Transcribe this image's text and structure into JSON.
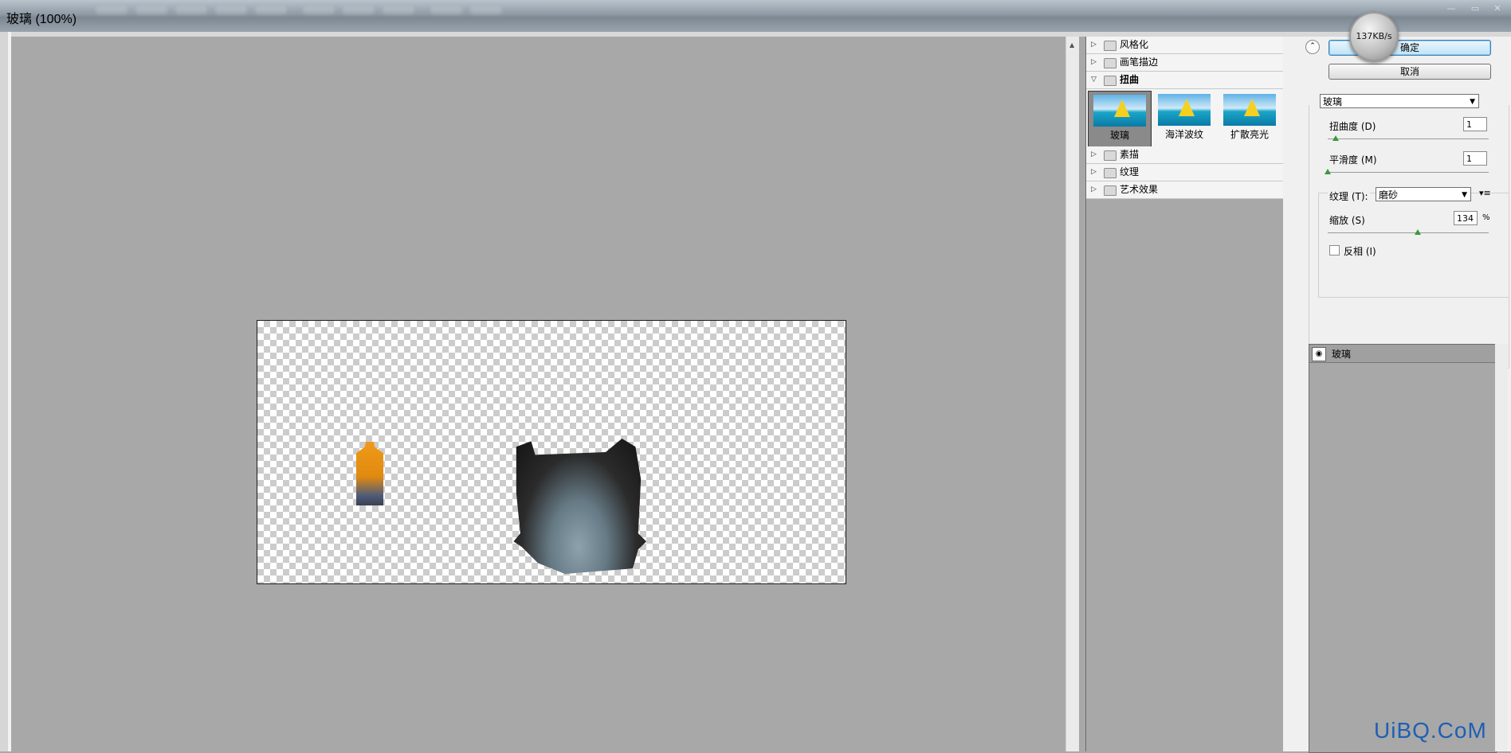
{
  "window": {
    "title": "玻璃 (100%)",
    "speed_badge": "137KB/s"
  },
  "filter_gallery": {
    "folders": [
      {
        "label": "风格化",
        "expanded": false
      },
      {
        "label": "画笔描边",
        "expanded": false
      },
      {
        "label": "扭曲",
        "expanded": true
      },
      {
        "label": "素描",
        "expanded": false
      },
      {
        "label": "纹理",
        "expanded": false
      },
      {
        "label": "艺术效果",
        "expanded": false
      }
    ],
    "thumbnails": [
      {
        "label": "玻璃",
        "selected": true
      },
      {
        "label": "海洋波纹",
        "selected": false
      },
      {
        "label": "扩散亮光",
        "selected": false
      }
    ]
  },
  "settings": {
    "ok_label": "确定",
    "cancel_label": "取消",
    "filter_select": "玻璃",
    "distortion": {
      "label": "扭曲度 (D)",
      "value": "1",
      "level": 0.05
    },
    "smoothness": {
      "label": "平滑度 (M)",
      "value": "1",
      "level": 0.0
    },
    "texture": {
      "label": "纹理 (T):",
      "value": "磨砂"
    },
    "scaling": {
      "label": "缩放 (S)",
      "value": "134",
      "unit": "%",
      "level": 0.56
    },
    "invert": {
      "label": "反相 (I)",
      "checked": false
    }
  },
  "layers": {
    "items": [
      {
        "label": "玻璃",
        "visible": true
      }
    ]
  },
  "watermark": "UiBQ.CoM",
  "colors": {
    "primary_button": "#bfe3f7",
    "slider_thumb": "#3a9a3a",
    "watermark": "#1f5fb3"
  }
}
